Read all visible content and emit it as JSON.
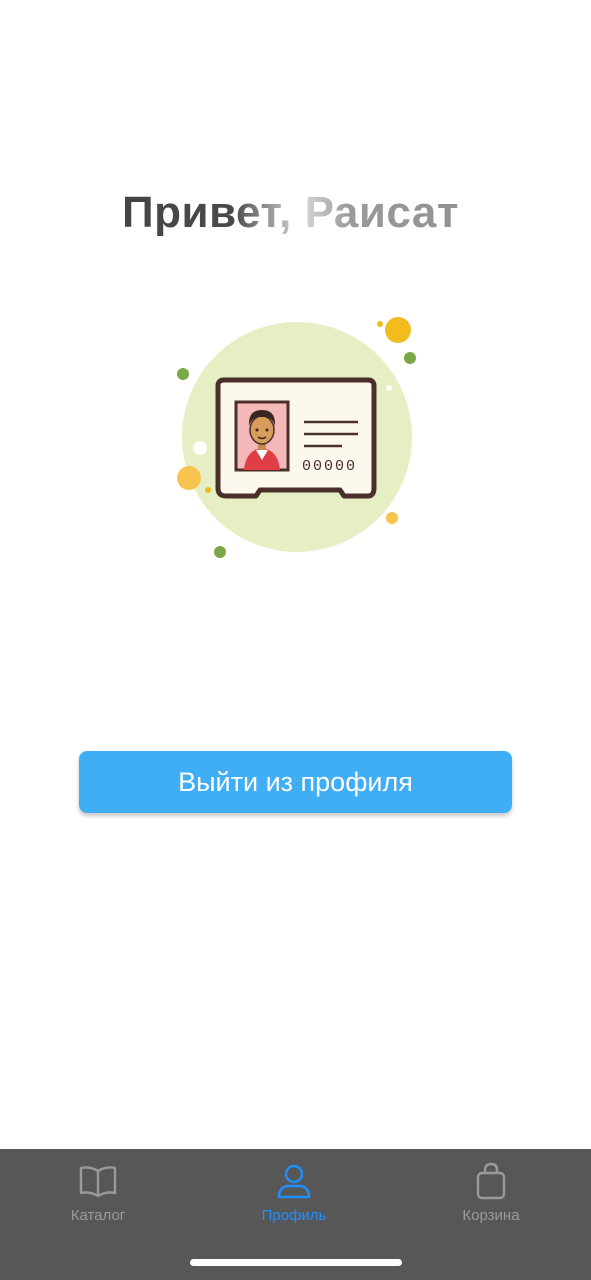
{
  "profile": {
    "greeting": "Привет, Раисат",
    "logout_label": "Выйти из профиля",
    "illustration_icon": "id-card-icon",
    "id_number_glyphs": "00000"
  },
  "tabbar": {
    "tabs": [
      {
        "label": "Каталог",
        "icon": "book-icon",
        "active": false
      },
      {
        "label": "Профиль",
        "icon": "person-icon",
        "active": true
      },
      {
        "label": "Корзина",
        "icon": "shopping-bag-icon",
        "active": false
      }
    ]
  },
  "colors": {
    "accent": "#40aef5",
    "active_tab": "#1f8fff",
    "inactive_tab": "#9a9a9a",
    "tabbar_bg": "#575757",
    "card_circle": "#e6efc4"
  }
}
